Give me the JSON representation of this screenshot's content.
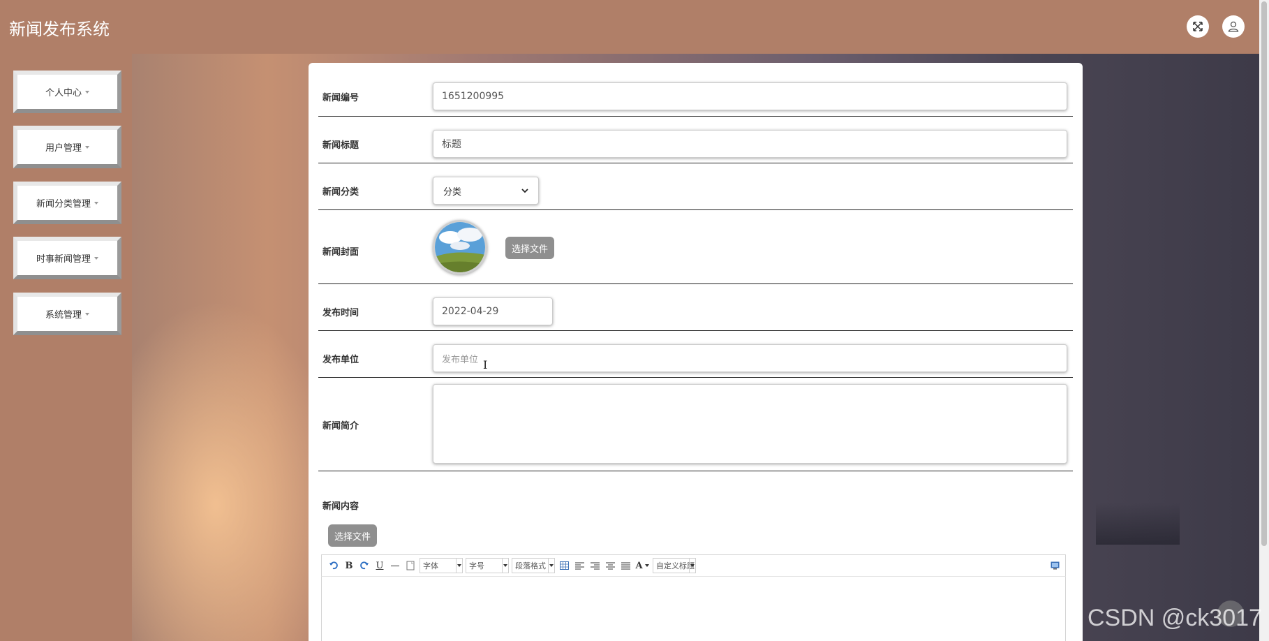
{
  "app": {
    "title": "新闻发布系统"
  },
  "header": {
    "fullscreen_icon": "expand-icon",
    "user_icon": "user-icon"
  },
  "sidebar": {
    "items": [
      {
        "label": "个人中心"
      },
      {
        "label": "用户管理"
      },
      {
        "label": "新闻分类管理"
      },
      {
        "label": "时事新闻管理"
      },
      {
        "label": "系统管理"
      }
    ]
  },
  "form": {
    "news_no": {
      "label": "新闻编号",
      "value": "1651200995"
    },
    "news_title": {
      "label": "新闻标题",
      "value": "标题"
    },
    "news_category": {
      "label": "新闻分类",
      "selected": "分类"
    },
    "news_cover": {
      "label": "新闻封面",
      "button": "选择文件"
    },
    "publish_time": {
      "label": "发布时间",
      "value": "2022-04-29"
    },
    "publisher": {
      "label": "发布单位",
      "placeholder": "发布单位"
    },
    "summary": {
      "label": "新闻简介",
      "value": ""
    },
    "content": {
      "label": "新闻内容",
      "button": "选择文件"
    }
  },
  "editor": {
    "font_label": "字体",
    "size_label": "字号",
    "paragraph_label": "段落格式",
    "custom_title_label": "自定义标题"
  },
  "watermark": "CSDN @ck3017"
}
